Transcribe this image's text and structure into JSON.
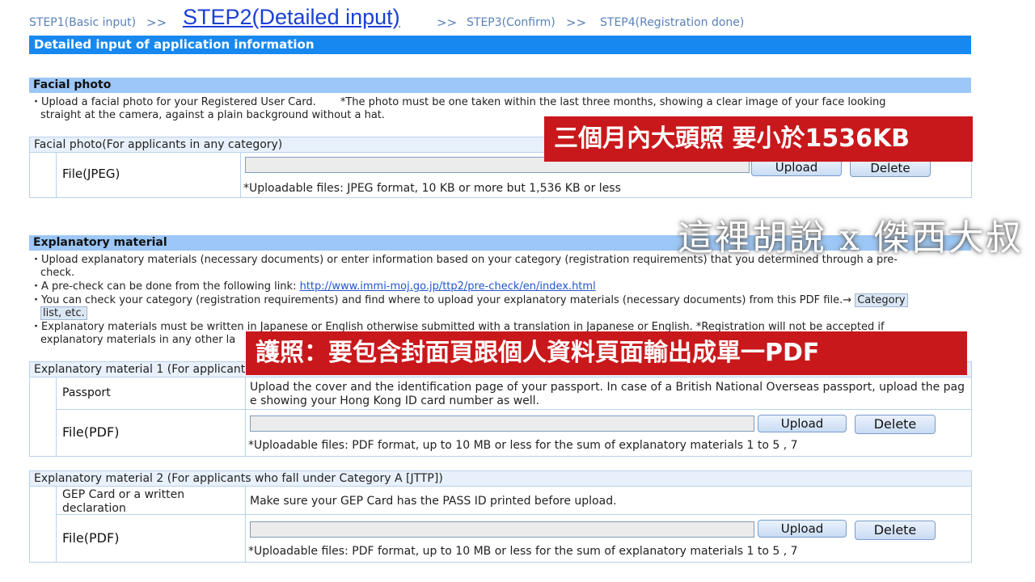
{
  "steps": {
    "step1": "STEP1(Basic input)",
    "step2": "STEP2(Detailed input)",
    "step3": "STEP3(Confirm)",
    "step4": "STEP4(Registration done)",
    "separator": ">>"
  },
  "main_header": "Detailed input of application information",
  "facial": {
    "header": "Facial photo",
    "line1": "・Upload a facial photo for your Registered User Card.　　 *The photo must be one taken within the last three months, showing a clear image of your face looking",
    "line2": "straight at the camera, against a plain background without a hat.",
    "box_title": "Facial photo(For applicants in any category)",
    "file_label": "File(JPEG)",
    "upload": "Upload",
    "delete": "Delete",
    "note": "*Uploadable files: JPEG format, 10 KB or more but 1,536 KB or less"
  },
  "explanatory": {
    "header": "Explanatory material",
    "l1": "・Upload explanatory materials (necessary documents) or enter information based on your category (registration requirements) that you determined through a pre-",
    "l2": "check.",
    "l3_prefix": "・A pre-check can be done from the following link: ",
    "l3_link": "http://www.immi-moj.go.jp/ttp2/pre-check/en/index.html",
    "l4": "・You can check your category (registration requirements) and find where to upload your explanatory materials (necessary documents) from this PDF file.→ ",
    "l4_link": "Category",
    "l5_link": "list, etc.",
    "l6": "・Explanatory materials must be written in Japanese or English otherwise submitted with a translation in Japanese or English. *Registration will not be accepted if",
    "l7": "explanatory materials in any other la"
  },
  "mat1": {
    "title": "Explanatory material 1 (For applicants",
    "row_label": "Passport",
    "desc1": "Upload the cover and the identification page of your passport. In case of a British National Overseas passport, upload the pag",
    "desc2": "e showing your Hong Kong ID card number as well.",
    "file_label": "File(PDF)",
    "upload": "Upload",
    "delete": "Delete",
    "note": "*Uploadable files: PDF format, up to 10 MB or less for the sum of explanatory materials 1 to 5 , 7"
  },
  "mat2": {
    "title": "Explanatory material 2 (For applicants who fall under Category A [JTTP])",
    "row_label1": "GEP Card or a written",
    "row_label2": "declaration",
    "desc": "Make sure your GEP Card has the PASS ID printed before upload.",
    "file_label": "File(PDF)",
    "upload": "Upload",
    "delete": "Delete",
    "note": "*Uploadable files: PDF format, up to 10 MB or less for the sum of explanatory materials 1 to 5 , 7"
  },
  "overlays": {
    "banner1": "三個月內大頭照 要小於1536KB",
    "banner2": "護照：要包含封面頁跟個人資料頁面輸出成單一PDF",
    "watermark": "這裡胡說 x 傑西大叔"
  },
  "colors": {
    "accent": "#1788f0",
    "section": "#9cc7f6",
    "banner": "#c9181b"
  }
}
